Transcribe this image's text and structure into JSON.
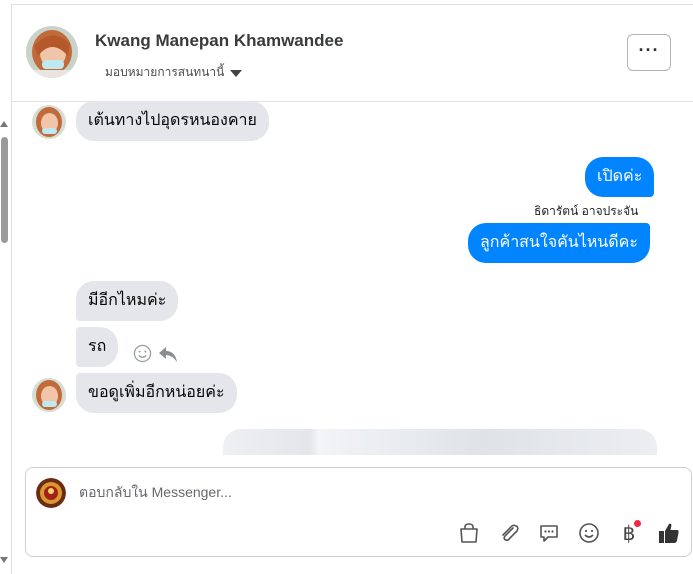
{
  "header": {
    "contact_name": "Kwang Manepan Khamwandee",
    "assign_label": "มอบหมายการสนทนานี้",
    "more_label": "···"
  },
  "messages": [
    {
      "id": "m1",
      "direction": "incoming",
      "text": "เต้นทางไปอุดรหนองคาย"
    },
    {
      "id": "m2",
      "direction": "outgoing",
      "text": "เปิดค่ะ"
    },
    {
      "id": "m3",
      "direction": "outgoing",
      "sender": "ธิดารัตน์ อาจประจัน",
      "text": "ลูกค้าสนใจคันไหนดีคะ"
    },
    {
      "id": "m4",
      "direction": "incoming",
      "text": "มีอีกไหมค่ะ"
    },
    {
      "id": "m5",
      "direction": "incoming",
      "text": "รถ"
    },
    {
      "id": "m6",
      "direction": "incoming",
      "text": "ขอดูเพิ่มอีกหน่อยค่ะ"
    }
  ],
  "composer": {
    "placeholder": "ตอบกลับใน Messenger..."
  },
  "icons": [
    "smile-icon",
    "reply-icon",
    "shopping-bag-icon",
    "paperclip-icon",
    "saved-reply-icon",
    "emoji-icon",
    "baht-payment-icon",
    "thumbs-up-icon"
  ],
  "colors": {
    "outgoing_bubble": "#0084ff",
    "incoming_bubble": "#e4e6eb",
    "notification_dot": "#f0284a"
  }
}
